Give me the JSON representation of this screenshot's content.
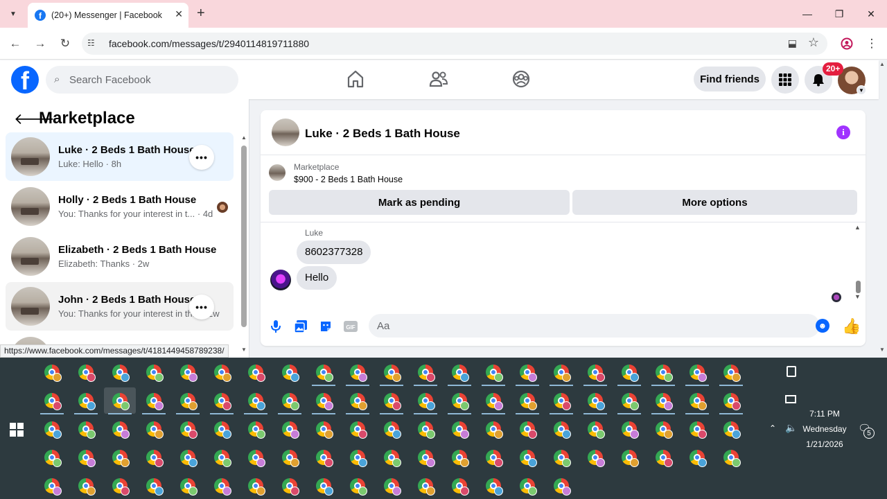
{
  "browser": {
    "tab_title": "(20+) Messenger | Facebook",
    "url": "facebook.com/messages/t/2940114819711880",
    "status_url": "https://www.facebook.com/messages/t/4181449458789238/"
  },
  "fb_header": {
    "search_placeholder": "Search Facebook",
    "find_friends": "Find friends",
    "notif_count": "20+"
  },
  "sidebar": {
    "title": "Marketplace",
    "conversations": [
      {
        "name": "Luke · 2 Beds 1 Bath House",
        "snippet": "Luke: Hello · 8h"
      },
      {
        "name": "Holly · 2 Beds 1 Bath House",
        "snippet": "You: Thanks for your interest in t... · 4d"
      },
      {
        "name": "Elizabeth · 2 Beds 1 Bath House",
        "snippet": "Elizabeth: Thanks · 2w"
      },
      {
        "name": "John · 2 Beds 1 Bath House",
        "snippet": "You: Thanks for your interest in th... · 2w"
      }
    ]
  },
  "chat": {
    "title": "Luke · 2 Beds 1 Bath House",
    "listing_label": "Marketplace",
    "listing_title": "$900 - 2 Beds 1 Bath House",
    "mark_pending": "Mark as pending",
    "more_options": "More options",
    "sender": "Luke",
    "messages": [
      "8602377328",
      "Hello"
    ],
    "input_placeholder": "Aa"
  },
  "taskbar": {
    "time": "7:11 PM",
    "day": "Wednesday",
    "date": "1/21/2026",
    "notification_count": "5",
    "profile_colors": [
      "#e0a030",
      "#d94a6b",
      "#4aa3d9",
      "#7bc96f",
      "#c77dd8"
    ]
  }
}
